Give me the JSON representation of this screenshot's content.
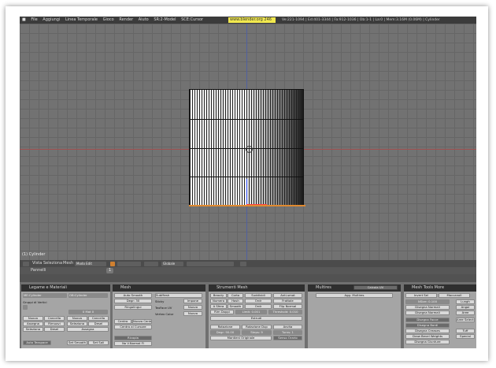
{
  "menubar": {
    "items": [
      "File",
      "Aggiungi",
      "Linea Temporale",
      "Gioco",
      "Render",
      "Aiuto"
    ],
    "screen": "SR:2-Model",
    "scene": "SCE:Cursor",
    "url": "www.blender.org 246",
    "stats": "Ve:221-1094 | Ed:401-3344 | Fa:912-1036 | Ob:1-1 | La:0 | Mem:3.16M (0.06M) | Cylinder"
  },
  "viewport": {
    "object_label": "(1) Cylinder"
  },
  "header": {
    "items": [
      "Vista",
      "Seleziona",
      "Mesh"
    ],
    "mode": "Modo Edit",
    "pivot": "Globale"
  },
  "props_header": {
    "label": "Pannelli",
    "page": "1"
  },
  "panels": {
    "link": {
      "title": "Legame e Materiali",
      "me": "ME:Cylinder",
      "ob": "OB:Cylinder",
      "vgroups": "Gruppi di Vertici",
      "mat": "0 Mat 0",
      "buttons": [
        "Nuovo",
        "Cancella",
        "Nuovo",
        "Cancella",
        "Assegna",
        "Rimuovi",
        "Seleziona",
        "Desel",
        "Seleziona",
        "Desel",
        "Assegna"
      ],
      "bottom": [
        "Auto Texspace",
        "Set Smooth",
        "Set Soli"
      ]
    },
    "mesh": {
      "title": "Mesh",
      "auto_smooth": "Auto Smooth",
      "degr": "Degr: 30",
      "subsurf": "SubMesh",
      "rinumera": "Ringolingui",
      "sticky": "Sticky",
      "uv": "TexFace UV",
      "vcol": "Vertex Color",
      "btn_right": [
        "Impone",
        "Nuovo",
        "Nuovo"
      ],
      "center": [
        "Centro",
        "Nuovo Centro",
        "Centro al Cursore"
      ],
      "tex": "Ricopia",
      "double": "No V.Normal Fl"
    },
    "tools": {
      "title": "Strumenti Mesh",
      "row1": [
        "Beauty",
        "Corto",
        "Suddividi",
        "Anti-smat"
      ],
      "row2": [
        "Numero",
        "Hash",
        "Ordr",
        "Frattale"
      ],
      "row3": [
        "A Sfera",
        "Smooth",
        "Ordr",
        "Flip Normal"
      ],
      "row4": [
        "Rim Doppi",
        "Limit: 0.001",
        "Threshold: 0.010"
      ],
      "extrude": "Estrudi",
      "row6": [
        "Rotazione",
        "Rotazione Dup",
        "Avvita"
      ],
      "row7": [
        "Degr: 90.00",
        "Steps: 9",
        "Turns: 1"
      ],
      "keep": "Mantieni Originale",
      "clock": "Senso Orario"
    },
    "multires": {
      "title": "Multires",
      "tab": "Calcola UV",
      "btn": "Agg. Multires"
    },
    "tools_more": {
      "title": "Mesh Tools More",
      "sel": [
        "Invert Sel",
        "Maccanoll"
      ],
      "nsize": "NSize: 0.100",
      "buttons": [
        "Disegna Normali",
        "Disegna Normali",
        "Disegna Facce",
        "Disegna Bordi",
        "Disegna Creases",
        "Draw Bevel Weights",
        "Disegna Giunture"
      ],
      "right": [
        "Lungh",
        "Angol",
        "Aree",
        "Aree Selecte",
        "Tuff",
        "Special"
      ]
    }
  }
}
